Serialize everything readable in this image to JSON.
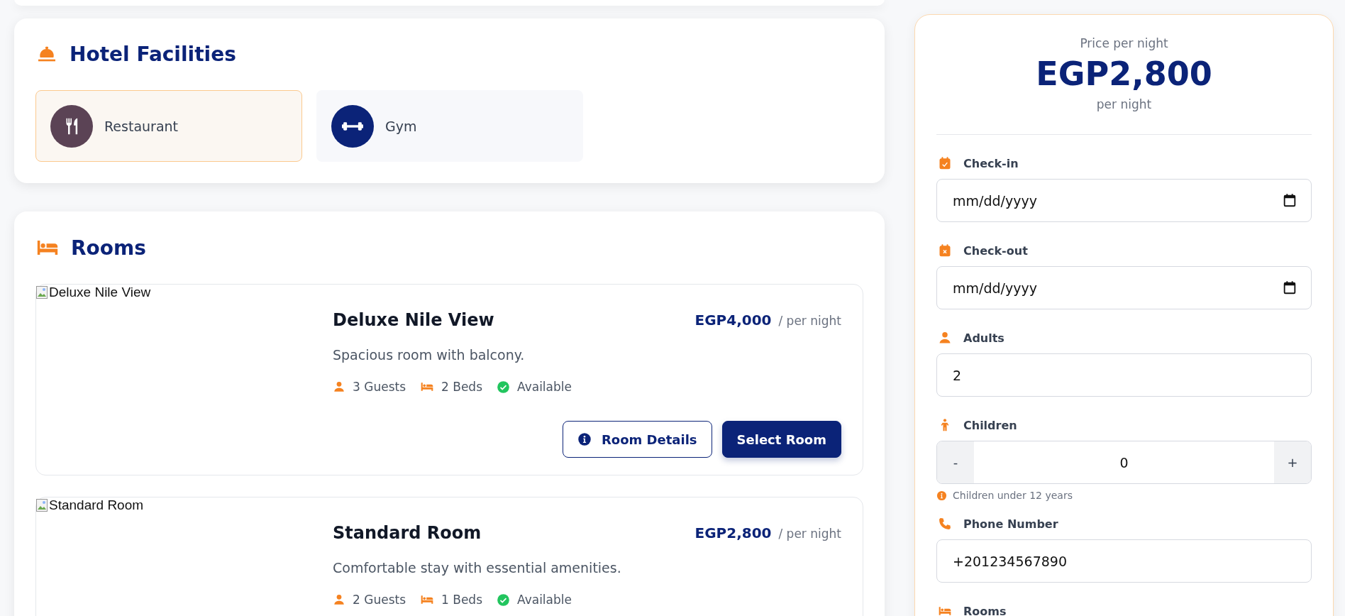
{
  "facilities": {
    "title": "Hotel Facilities",
    "items": [
      {
        "label": "Restaurant",
        "color": "#5b4355",
        "selected": true
      },
      {
        "label": "Gym",
        "color": "#0b2378",
        "selected": false
      }
    ]
  },
  "rooms": {
    "title": "Rooms",
    "items": [
      {
        "image_alt": "Deluxe Nile View",
        "name": "Deluxe Nile View",
        "price": "EGP4,000",
        "price_unit": "/ per night",
        "description": "Spacious room with balcony.",
        "guests": "3 Guests",
        "beds": "2 Beds",
        "status": "Available",
        "available": true,
        "buttons": [
          "Room Details",
          "Select Room"
        ]
      },
      {
        "image_alt": "Standard Room",
        "name": "Standard Room",
        "price": "EGP2,800",
        "price_unit": "/ per night",
        "description": "Comfortable stay with essential amenities.",
        "guests": "2 Guests",
        "beds": "1 Beds",
        "status": "Available",
        "available": true
      }
    ]
  },
  "booking": {
    "price_label": "Price per night",
    "price": "EGP2,800",
    "price_unit": "per night",
    "fields": [
      {
        "kind": "date",
        "label": "Check-in",
        "placeholder": "mm/dd/yyyy"
      },
      {
        "kind": "date",
        "label": "Check-out",
        "placeholder": "mm/dd/yyyy"
      },
      {
        "kind": "text",
        "label": "Adults",
        "value": "2"
      },
      {
        "kind": "stepper",
        "label": "Children",
        "value": "0",
        "minus": "-",
        "plus": "+",
        "hint": "Children under 12 years"
      },
      {
        "kind": "text",
        "label": "Phone Number",
        "value": "+201234567890"
      },
      {
        "kind": "label",
        "label": "Rooms"
      }
    ]
  }
}
